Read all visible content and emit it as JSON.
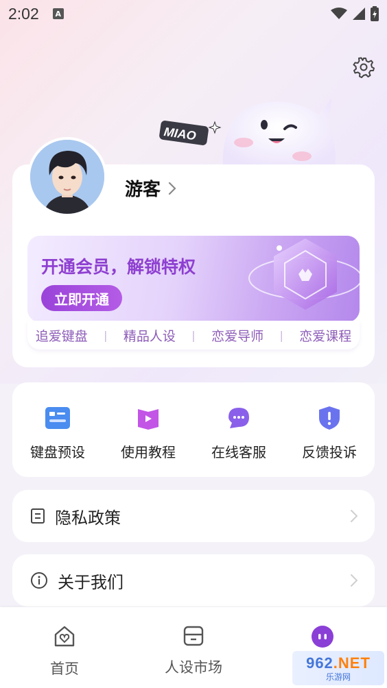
{
  "status_bar": {
    "time": "2:02",
    "notification_letter": "A"
  },
  "header": {
    "settings_icon": "gear-icon"
  },
  "mascot": {
    "tag": "MIAO"
  },
  "profile": {
    "username": "游客"
  },
  "vip": {
    "title": "开通会员，解锁特权",
    "button": "立即开通",
    "features": [
      "追爱键盘",
      "精品人设",
      "恋爱导师",
      "恋爱课程"
    ],
    "separator": "|"
  },
  "tools": [
    {
      "label": "键盘预设",
      "icon": "keyboard-preset-icon"
    },
    {
      "label": "使用教程",
      "icon": "tutorial-play-icon"
    },
    {
      "label": "在线客服",
      "icon": "chat-bubble-icon"
    },
    {
      "label": "反馈投诉",
      "icon": "shield-alert-icon"
    }
  ],
  "menu": {
    "privacy": "隐私政策",
    "about": "关于我们"
  },
  "tabbar": {
    "tabs": [
      {
        "label": "首页",
        "icon": "home-heart-icon"
      },
      {
        "label": "人设市场",
        "icon": "market-box-icon"
      },
      {
        "label": "",
        "icon": "profile-face-icon"
      }
    ]
  },
  "watermark": {
    "brand_num": "962",
    "brand_tld": ".NET",
    "brand_cn": "乐游网"
  },
  "colors": {
    "accent": "#9a43d9",
    "vip_text": "#8e3fd0",
    "feature_text": "#8d5cb8"
  }
}
